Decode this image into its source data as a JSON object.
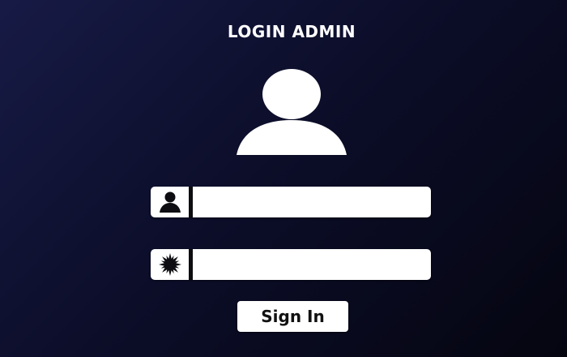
{
  "header": {
    "title": "LOGIN ADMIN"
  },
  "avatar": {
    "icon": "user-avatar-icon"
  },
  "form": {
    "username": {
      "icon": "user-icon",
      "value": "",
      "placeholder": ""
    },
    "password": {
      "icon": "asterisk-icon",
      "value": "",
      "placeholder": ""
    },
    "submit_label": "Sign In"
  },
  "colors": {
    "background_top": "#171a45",
    "background_bottom": "#050510",
    "foreground": "#ffffff",
    "icon": "#0d0d12"
  }
}
